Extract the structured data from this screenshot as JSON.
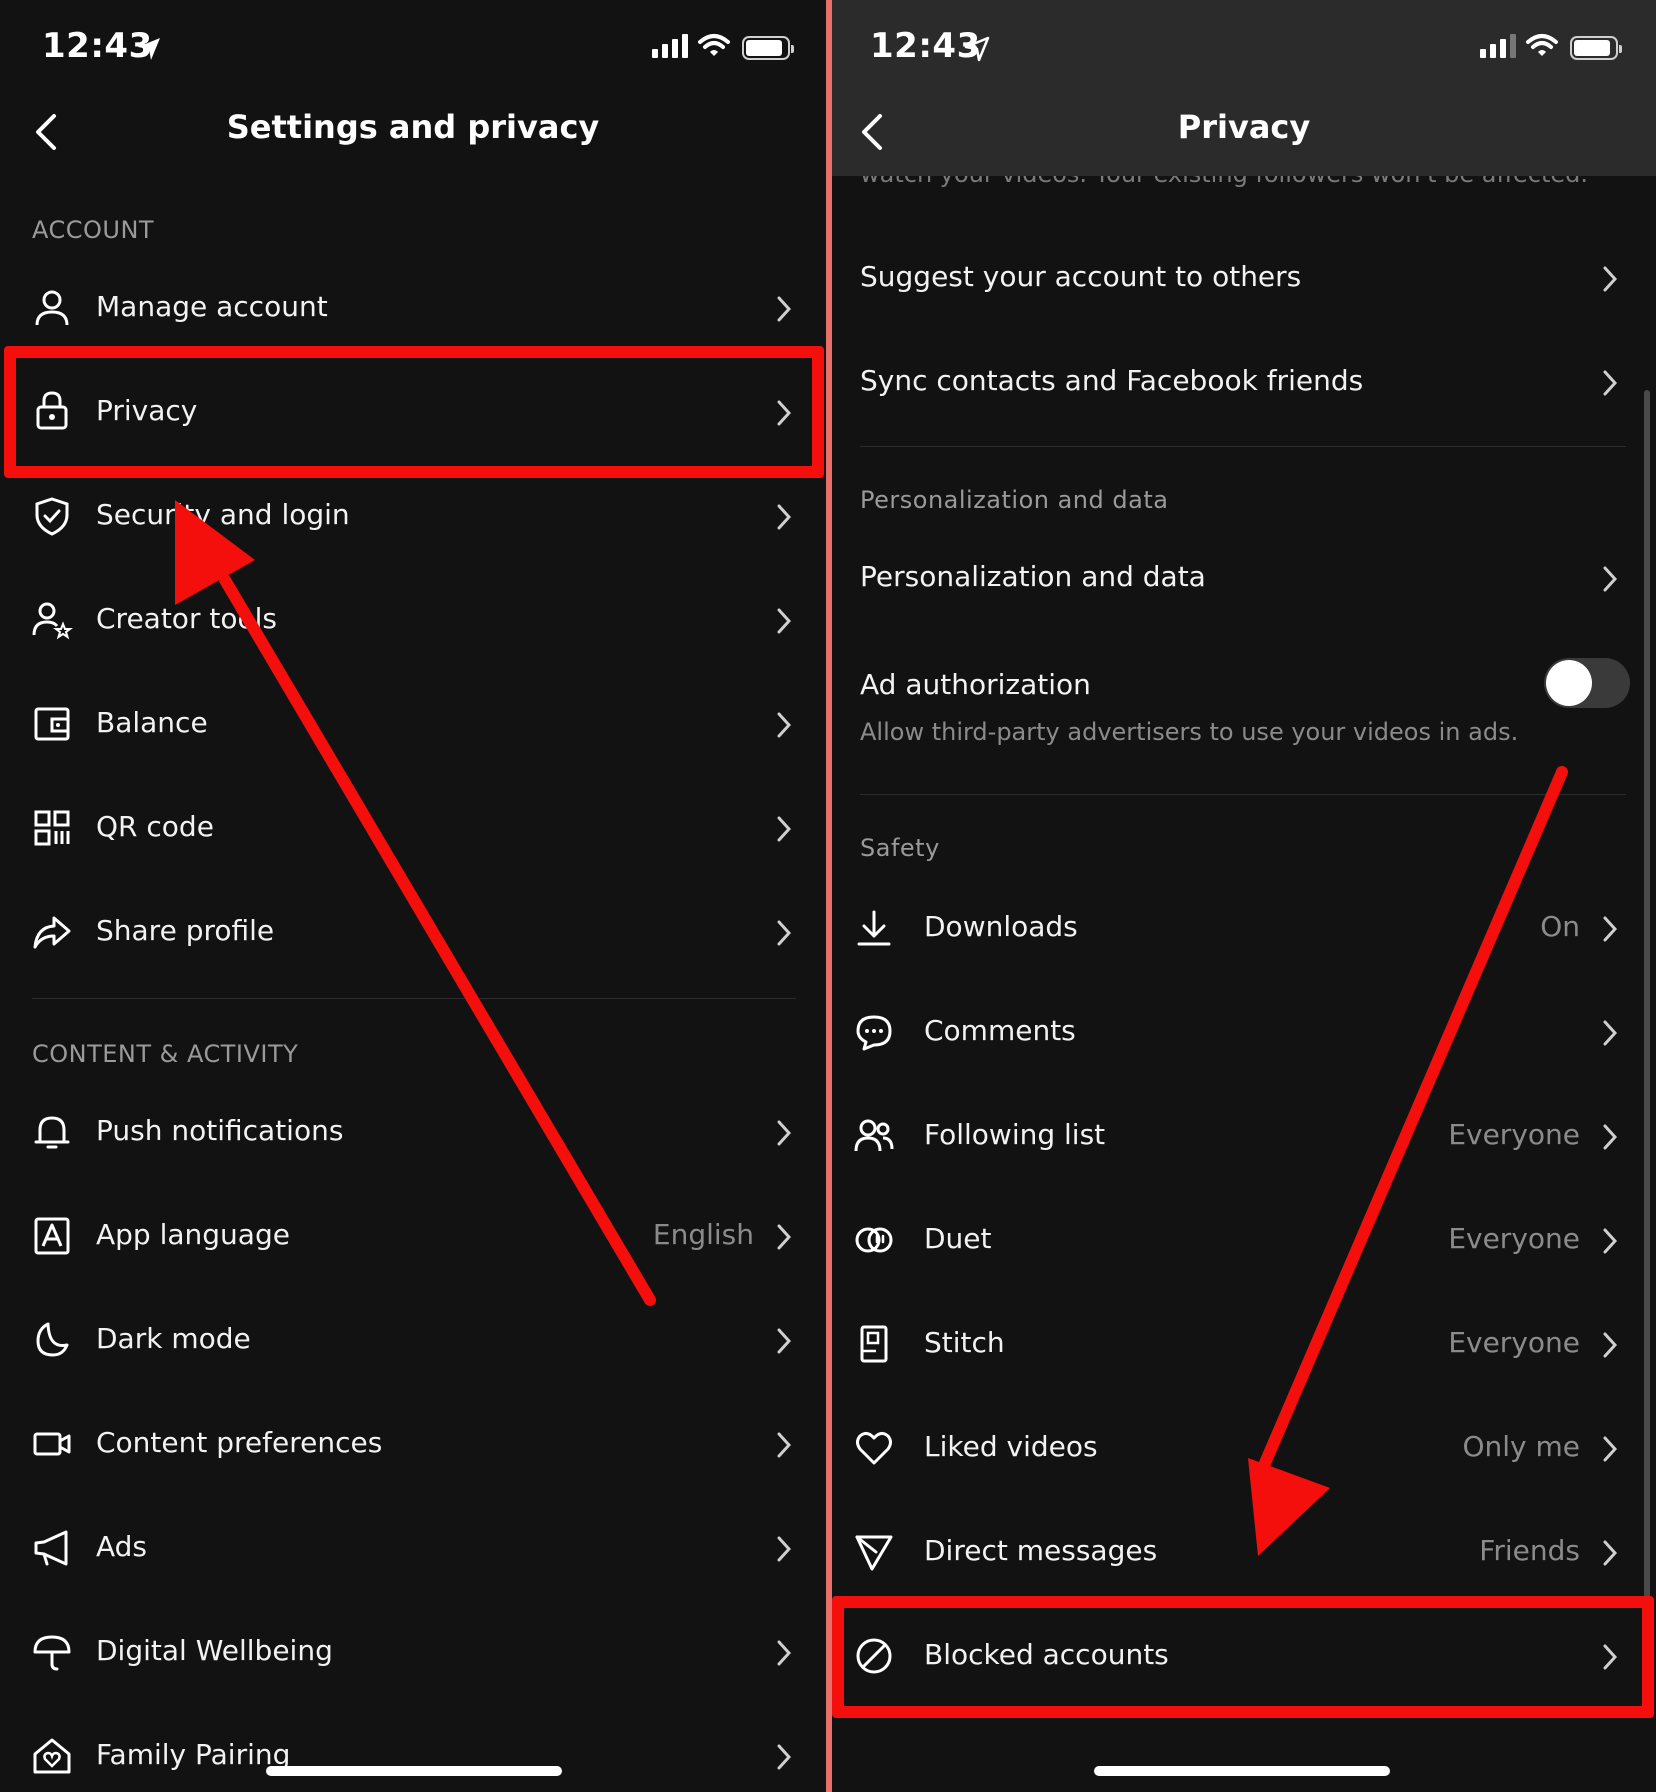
{
  "left": {
    "status": {
      "time": "12:43"
    },
    "header": {
      "title": "Settings and privacy"
    },
    "sections": {
      "account": "ACCOUNT",
      "content_activity": "CONTENT & ACTIVITY"
    },
    "items": {
      "manage_account": "Manage account",
      "privacy": "Privacy",
      "security_login": "Security and login",
      "creator_tools": "Creator tools",
      "balance": "Balance",
      "qr_code": "QR code",
      "share_profile": "Share profile",
      "push_notifications": "Push notifications",
      "app_language": "App language",
      "app_language_value": "English",
      "dark_mode": "Dark mode",
      "content_preferences": "Content preferences",
      "ads": "Ads",
      "digital_wellbeing": "Digital Wellbeing",
      "family_pairing": "Family Pairing"
    }
  },
  "right": {
    "status": {
      "time": "12:43"
    },
    "header": {
      "title": "Privacy"
    },
    "partial_text": "watch your videos. Your existing followers won't be affected.",
    "items": {
      "suggest_account": "Suggest your account to others",
      "sync_contacts": "Sync contacts and Facebook friends",
      "personalization_section": "Personalization and data",
      "personalization_item": "Personalization and data",
      "ad_authorization": "Ad authorization",
      "ad_authorization_desc": "Allow third-party advertisers to use your videos in ads.",
      "safety_section": "Safety",
      "downloads": "Downloads",
      "downloads_value": "On",
      "comments": "Comments",
      "following_list": "Following list",
      "following_list_value": "Everyone",
      "duet": "Duet",
      "duet_value": "Everyone",
      "stitch": "Stitch",
      "stitch_value": "Everyone",
      "liked_videos": "Liked videos",
      "liked_videos_value": "Only me",
      "direct_messages": "Direct messages",
      "direct_messages_value": "Friends",
      "blocked_accounts": "Blocked accounts"
    }
  },
  "colors": {
    "background": "#121212",
    "header_right": "#2b2b2b",
    "annotation_red": "#f40f0c",
    "divider": "#e8706a"
  },
  "icons": {
    "status_location": "location-arrow-icon",
    "status_signal": "cellular-signal-icon",
    "status_wifi": "wifi-icon",
    "status_battery": "battery-icon"
  }
}
